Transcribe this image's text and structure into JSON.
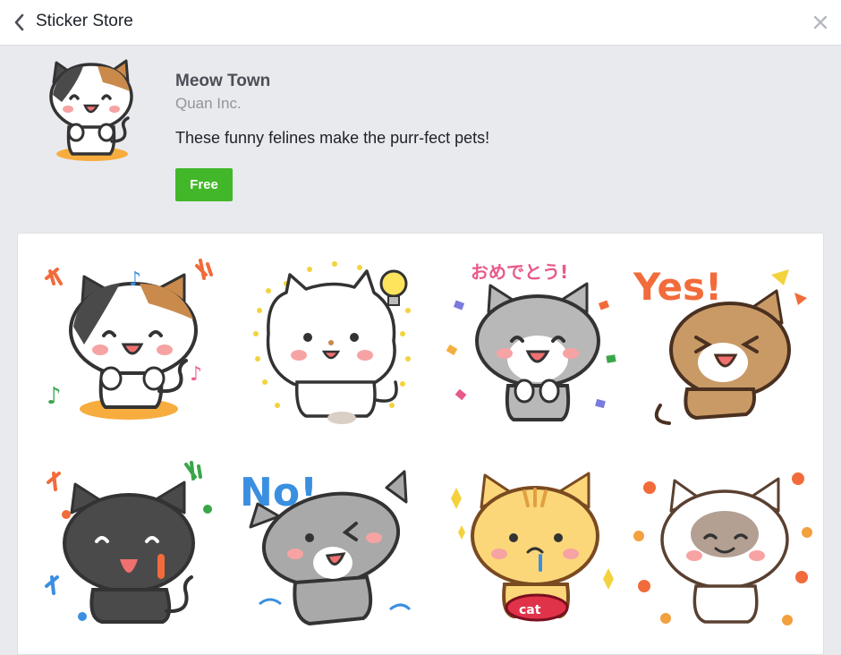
{
  "header": {
    "title": "Sticker Store",
    "back_icon": "chevron-left-icon",
    "close_icon": "close-icon"
  },
  "pack": {
    "name": "Meow Town",
    "author": "Quan Inc.",
    "description": "These funny felines make the purr-fect pets!",
    "price_label": "Free",
    "price_button_color": "#42b72a"
  },
  "stickers": [
    {
      "name": "calico-cat-happy"
    },
    {
      "name": "white-fluffy-cat-idea",
      "caption": ""
    },
    {
      "name": "grey-cat-congrats",
      "caption": "おめでとう!"
    },
    {
      "name": "tabby-cat-yes",
      "caption": "Yes!"
    },
    {
      "name": "black-cat-tongue"
    },
    {
      "name": "grey-tabby-cat-no",
      "caption": "No!"
    },
    {
      "name": "orange-tabby-cat-bowl",
      "caption": "cat"
    },
    {
      "name": "siamese-cat-flowers"
    }
  ]
}
